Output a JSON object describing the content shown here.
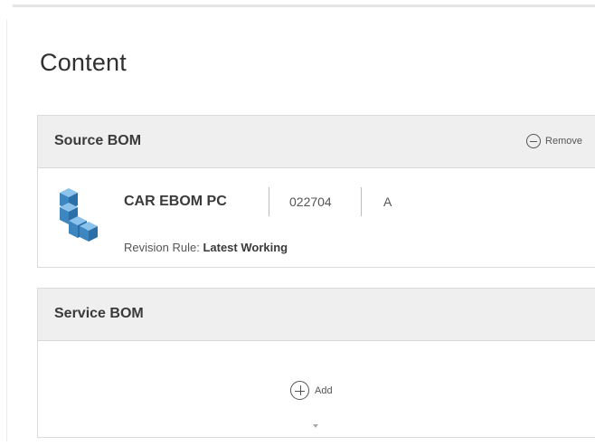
{
  "page": {
    "title": "Content"
  },
  "source_bom": {
    "header": "Source BOM",
    "remove_label": "Remove",
    "item": {
      "icon": "cube-stack-icon",
      "name": "CAR EBOM PC",
      "id": "022704",
      "revision": "A",
      "revision_rule_label": "Revision Rule:",
      "revision_rule_value": "Latest Working"
    }
  },
  "service_bom": {
    "header": "Service BOM",
    "add_label": "Add"
  },
  "colors": {
    "header_bg": "#efefef",
    "cube": "#4a8fc4"
  }
}
